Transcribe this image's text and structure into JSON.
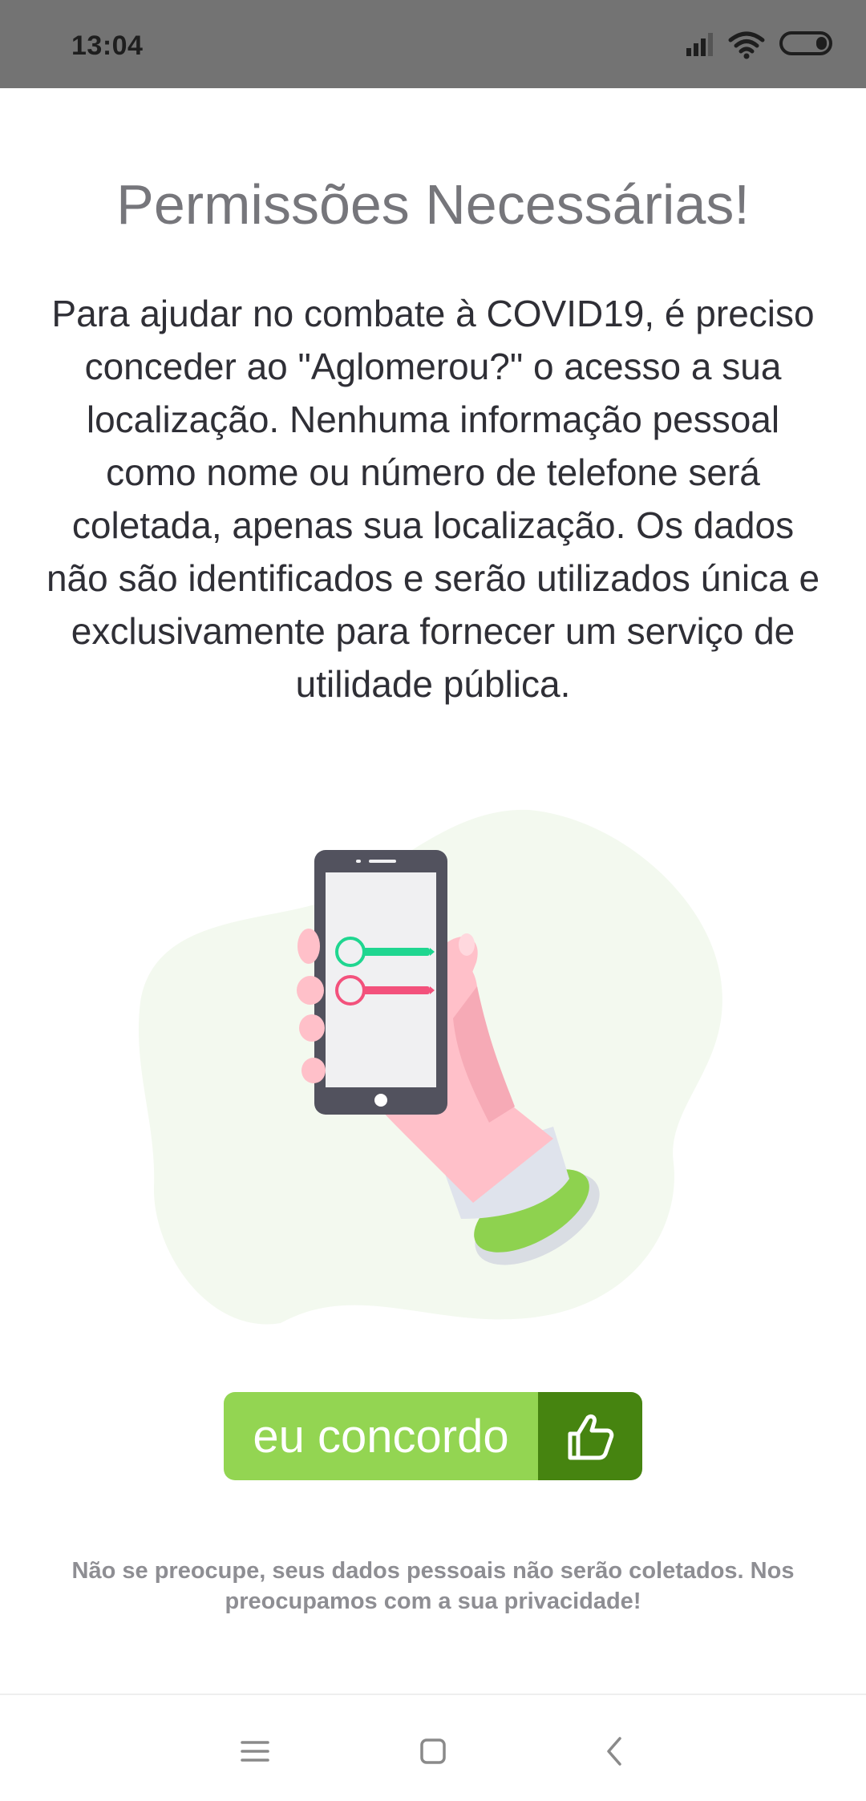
{
  "status_bar": {
    "time": "13:04"
  },
  "screen": {
    "title": "Permissões Necessárias!",
    "body": "Para ajudar no combate à COVID19, é preciso conceder ao \"Aglomerou?\" o acesso a sua localização. Nenhuma informação pessoal como nome ou número de telefone será coletada, apenas sua localização. Os dados não são identificados e serão utilizados única e exclusivamente para fornecer um serviço de utilidade pública.",
    "illustration_icon": "hand-holding-phone-illustration",
    "agree_button": {
      "label": "eu concordo",
      "icon": "thumbs-up-icon"
    },
    "footer_note": "Não se preocupe, seus dados pessoais não serão coletados. Nos preocupamos com a sua privacidade!"
  },
  "nav_bar": {
    "items": [
      "menu-icon",
      "home-icon",
      "back-icon"
    ]
  },
  "colors": {
    "status_bar": "#737373",
    "title": "#76767b",
    "body_text": "#2f2f36",
    "button_primary": "#93d552",
    "button_icon_bg": "#468410",
    "footer_text": "#8e8e93",
    "toggle_green": "#1fd690",
    "toggle_pink": "#f3517c"
  }
}
